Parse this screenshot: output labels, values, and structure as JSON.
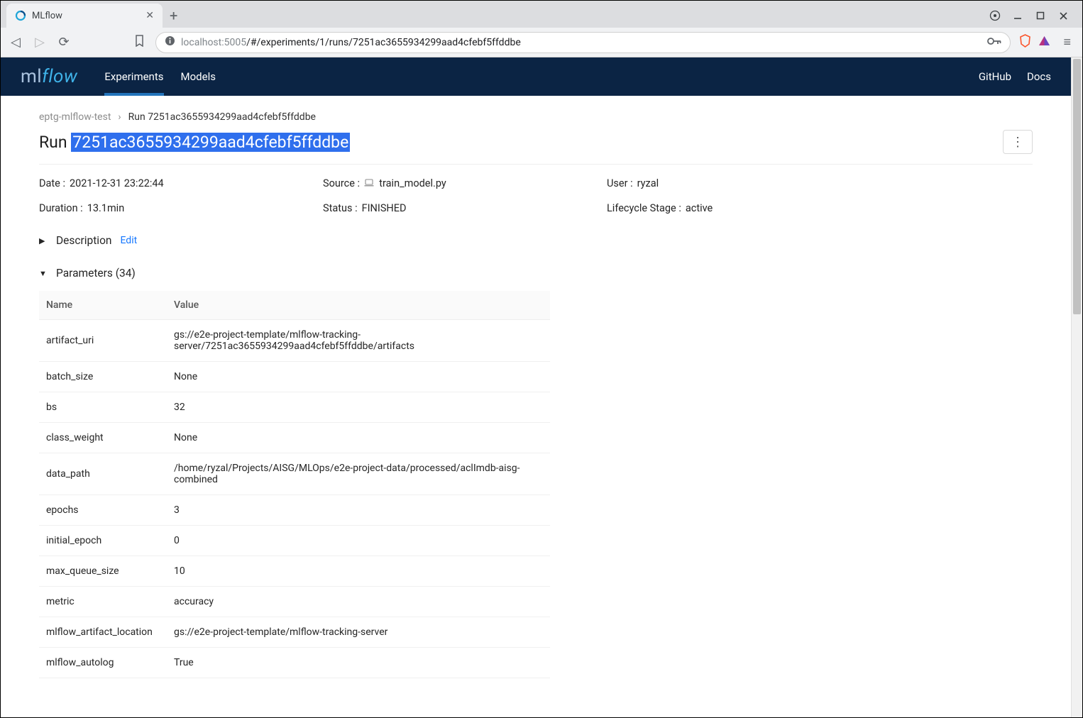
{
  "browser": {
    "tab_title": "MLflow",
    "url_host_dim1": "localhost",
    "url_host_dim2": ":5005",
    "url_path": "/#/experiments/1/runs/7251ac3655934299aad4cfebf5ffddbe"
  },
  "header": {
    "logo_ml": "ml",
    "logo_flow": "flow",
    "tabs": {
      "experiments": "Experiments",
      "models": "Models"
    },
    "links": {
      "github": "GitHub",
      "docs": "Docs"
    }
  },
  "breadcrumb": {
    "experiment": "eptg-mlflow-test",
    "current": "Run 7251ac3655934299aad4cfebf5ffddbe"
  },
  "title": {
    "prefix": "Run ",
    "selected": "7251ac3655934299aad4cfebf5ffddbe"
  },
  "meta": {
    "date_label": "Date",
    "date_value": "2021-12-31 23:22:44",
    "source_label": "Source",
    "source_value": "train_model.py",
    "user_label": "User",
    "user_value": "ryzal",
    "duration_label": "Duration",
    "duration_value": "13.1min",
    "status_label": "Status",
    "status_value": "FINISHED",
    "lifecycle_label": "Lifecycle Stage",
    "lifecycle_value": "active"
  },
  "sections": {
    "description_title": "Description",
    "edit": "Edit",
    "parameters_title": "Parameters (34)"
  },
  "params_table": {
    "col_name": "Name",
    "col_value": "Value",
    "rows": [
      {
        "name": "artifact_uri",
        "value": "gs://e2e-project-template/mlflow-tracking-server/7251ac3655934299aad4cfebf5ffddbe/artifacts"
      },
      {
        "name": "batch_size",
        "value": "None"
      },
      {
        "name": "bs",
        "value": "32"
      },
      {
        "name": "class_weight",
        "value": "None"
      },
      {
        "name": "data_path",
        "value": "/home/ryzal/Projects/AISG/MLOps/e2e-project-data/processed/aclImdb-aisg-combined"
      },
      {
        "name": "epochs",
        "value": "3"
      },
      {
        "name": "initial_epoch",
        "value": "0"
      },
      {
        "name": "max_queue_size",
        "value": "10"
      },
      {
        "name": "metric",
        "value": "accuracy"
      },
      {
        "name": "mlflow_artifact_location",
        "value": "gs://e2e-project-template/mlflow-tracking-server"
      },
      {
        "name": "mlflow_autolog",
        "value": "True"
      }
    ]
  }
}
